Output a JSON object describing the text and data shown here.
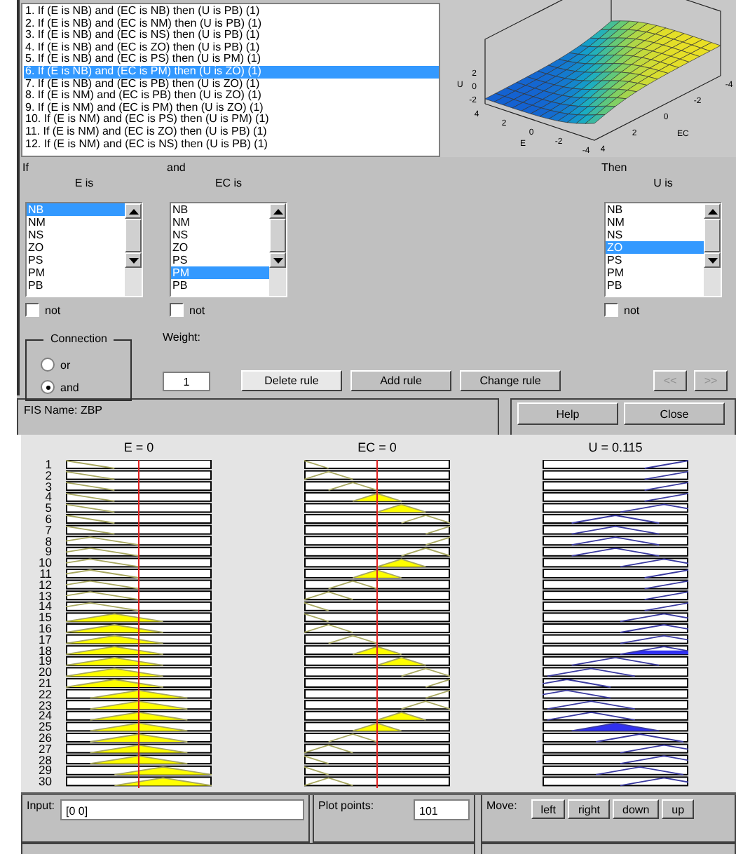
{
  "rule_list": {
    "rules": [
      {
        "text": "1. If (E is NB) and (EC is NB) then (U is PB) (1)",
        "selected": false
      },
      {
        "text": "2. If (E is NB) and (EC is NM) then (U is PB) (1)",
        "selected": false
      },
      {
        "text": "3. If (E is NB) and (EC is NS) then (U is PB) (1)",
        "selected": false
      },
      {
        "text": "4. If (E is NB) and (EC is ZO) then (U is PB) (1)",
        "selected": false
      },
      {
        "text": "5. If (E is NB) and (EC is PS) then (U is PM) (1)",
        "selected": false
      },
      {
        "text": "6. If (E is NB) and (EC is PM) then (U is ZO) (1)",
        "selected": true
      },
      {
        "text": "7. If (E is NB) and (EC is PB) then (U is ZO) (1)",
        "selected": false
      },
      {
        "text": "8. If (E is NM) and (EC is PB) then (U is ZO) (1)",
        "selected": false
      },
      {
        "text": "9. If (E is NM) and (EC is PM) then (U is ZO) (1)",
        "selected": false
      },
      {
        "text": "10. If (E is NM) and (EC is PS) then (U is PM) (1)",
        "selected": false
      },
      {
        "text": "11. If (E is NM) and (EC is ZO) then (U is PB) (1)",
        "selected": false
      },
      {
        "text": "12. If (E is NM) and (EC is NS) then (U is PB) (1)",
        "selected": false
      }
    ]
  },
  "surface_plot": {
    "zlabel": "U",
    "xlabel": "E",
    "ylabel": "EC",
    "zticks": [
      "2",
      "0",
      "-2"
    ],
    "xticks": [
      "4",
      "2",
      "0",
      "-2",
      "-4"
    ],
    "yticks": [
      "4",
      "2",
      "0",
      "-2",
      "-4"
    ]
  },
  "editor": {
    "variables": [
      {
        "heading": "If",
        "label": "E is",
        "not_label": "not",
        "not_checked": false,
        "items": [
          {
            "text": "NB",
            "selected": true
          },
          {
            "text": "NM",
            "selected": false
          },
          {
            "text": "NS",
            "selected": false
          },
          {
            "text": "ZO",
            "selected": false
          },
          {
            "text": "PS",
            "selected": false
          },
          {
            "text": "PM",
            "selected": false
          },
          {
            "text": "PB",
            "selected": false
          }
        ]
      },
      {
        "heading": "and",
        "label": "EC is",
        "not_label": "not",
        "not_checked": false,
        "items": [
          {
            "text": "NB",
            "selected": false
          },
          {
            "text": "NM",
            "selected": false
          },
          {
            "text": "NS",
            "selected": false
          },
          {
            "text": "ZO",
            "selected": false
          },
          {
            "text": "PS",
            "selected": false
          },
          {
            "text": "PM",
            "selected": true
          },
          {
            "text": "PB",
            "selected": false
          }
        ]
      },
      {
        "heading": "Then",
        "label": "U is",
        "not_label": "not",
        "not_checked": false,
        "items": [
          {
            "text": "NB",
            "selected": false
          },
          {
            "text": "NM",
            "selected": false
          },
          {
            "text": "NS",
            "selected": false
          },
          {
            "text": "ZO",
            "selected": true
          },
          {
            "text": "PS",
            "selected": false
          },
          {
            "text": "PM",
            "selected": false
          },
          {
            "text": "PB",
            "selected": false
          }
        ]
      }
    ],
    "connection": {
      "title": "Connection",
      "options": [
        {
          "label": "or",
          "selected": false
        },
        {
          "label": "and",
          "selected": true
        }
      ]
    },
    "weight": {
      "label": "Weight:",
      "value": "1"
    },
    "buttons": [
      {
        "label": "Delete rule",
        "disabled": false
      },
      {
        "label": "Add rule",
        "disabled": false
      },
      {
        "label": "Change rule",
        "disabled": false
      }
    ],
    "nav_buttons": [
      {
        "label": "<<",
        "disabled": true
      },
      {
        "label": ">>",
        "disabled": true
      }
    ]
  },
  "fis_name": "FIS Name: ZBP",
  "dialog_buttons": [
    "Help",
    "Close"
  ],
  "viewer": {
    "columns": [
      {
        "title": "E = 0",
        "kind": "input"
      },
      {
        "title": "EC = 0",
        "kind": "input"
      },
      {
        "title": "U = 0.115",
        "kind": "output"
      }
    ],
    "rows": [
      {
        "number": "1"
      },
      {
        "number": "2"
      },
      {
        "number": "3"
      },
      {
        "number": "4"
      },
      {
        "number": "5"
      },
      {
        "number": "6"
      },
      {
        "number": "7"
      },
      {
        "number": "8"
      },
      {
        "number": "9"
      },
      {
        "number": "10"
      },
      {
        "number": "11"
      },
      {
        "number": "12"
      },
      {
        "number": "13"
      },
      {
        "number": "14"
      },
      {
        "number": "15"
      },
      {
        "number": "16"
      },
      {
        "number": "17"
      },
      {
        "number": "18"
      },
      {
        "number": "19"
      },
      {
        "number": "20"
      },
      {
        "number": "21"
      },
      {
        "number": "22"
      },
      {
        "number": "23"
      },
      {
        "number": "24"
      },
      {
        "number": "25"
      },
      {
        "number": "26"
      },
      {
        "number": "27"
      },
      {
        "number": "28"
      },
      {
        "number": "29"
      },
      {
        "number": "30"
      }
    ]
  },
  "controls": {
    "input_label": "Input:",
    "input_value": "[0 0]",
    "points_label": "Plot points:",
    "points_value": "101",
    "move_label": "Move:",
    "move_buttons": [
      "left",
      "right",
      "down",
      "up"
    ]
  }
}
